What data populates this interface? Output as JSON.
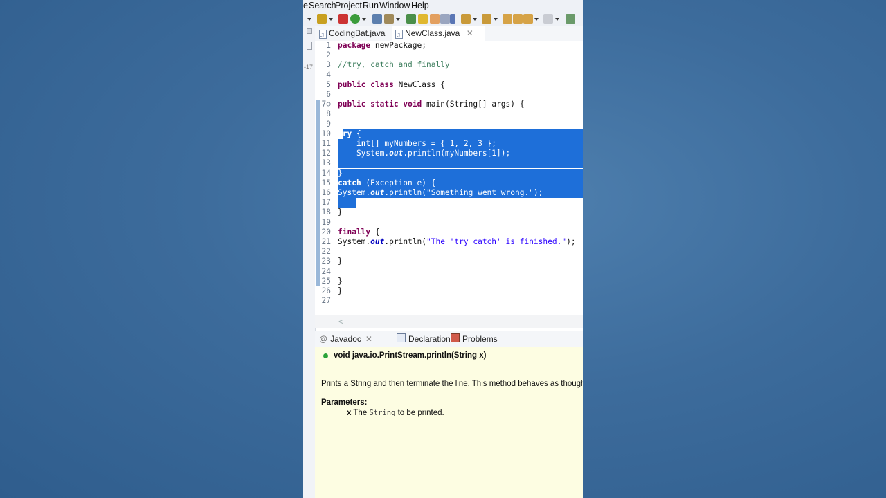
{
  "menu": [
    "e",
    "Search",
    "Project",
    "Run",
    "Window",
    "Help"
  ],
  "left_strip_text": "-17",
  "tabs": [
    {
      "label": "CodingBat.java"
    },
    {
      "label": "NewClass.java",
      "close": "✕"
    }
  ],
  "code_lines": [
    {
      "n": "1",
      "text": "package newPackage;"
    },
    {
      "n": "2",
      "text": ""
    },
    {
      "n": "3",
      "text": "//try, catch and finally"
    },
    {
      "n": "4",
      "text": ""
    },
    {
      "n": "5",
      "text": "public class NewClass {"
    },
    {
      "n": "6",
      "text": ""
    },
    {
      "n": "7⊖",
      "text": "public static void main(String[] args) {"
    },
    {
      "n": "8",
      "text": ""
    },
    {
      "n": "9",
      "text": ""
    },
    {
      "n": "10",
      "text": "try {"
    },
    {
      "n": "11",
      "text": "    int[] myNumbers = { 1, 2, 3 };"
    },
    {
      "n": "12",
      "text": "    System.out.println(myNumbers[1]);"
    },
    {
      "n": "13",
      "text": ""
    },
    {
      "n": "14",
      "text": "}"
    },
    {
      "n": "15",
      "text": "catch (Exception e) {"
    },
    {
      "n": "16",
      "text": "System.out.println(\"Something went wrong.\");"
    },
    {
      "n": "17",
      "text": ""
    },
    {
      "n": "18",
      "text": "}"
    },
    {
      "n": "19",
      "text": ""
    },
    {
      "n": "20",
      "text": "finally {"
    },
    {
      "n": "21",
      "text": "System.out.println(\"The 'try catch' is finished.\");"
    },
    {
      "n": "22",
      "text": ""
    },
    {
      "n": "23",
      "text": "}"
    },
    {
      "n": "24",
      "text": ""
    },
    {
      "n": "25",
      "text": "}"
    },
    {
      "n": "26",
      "text": "}"
    },
    {
      "n": "27",
      "text": ""
    }
  ],
  "view_tabs": [
    {
      "label": "Javadoc",
      "close": "✕"
    },
    {
      "label": "Declaration"
    },
    {
      "label": "Problems"
    }
  ],
  "javadoc": {
    "signature": "void java.io.PrintStream.println(String x)",
    "description": "Prints a String and then terminate the line. This method behaves as though it",
    "params_heading": "Parameters:",
    "param_name": "x",
    "param_text_before": "The",
    "param_code": "String",
    "param_text_after": "to be printed."
  },
  "colors": {
    "selection": "#1e6fd9",
    "keyword": "#7f0055",
    "comment": "#3f7f5f",
    "string": "#2a00ff",
    "javadoc_bg": "#fdfde2"
  }
}
